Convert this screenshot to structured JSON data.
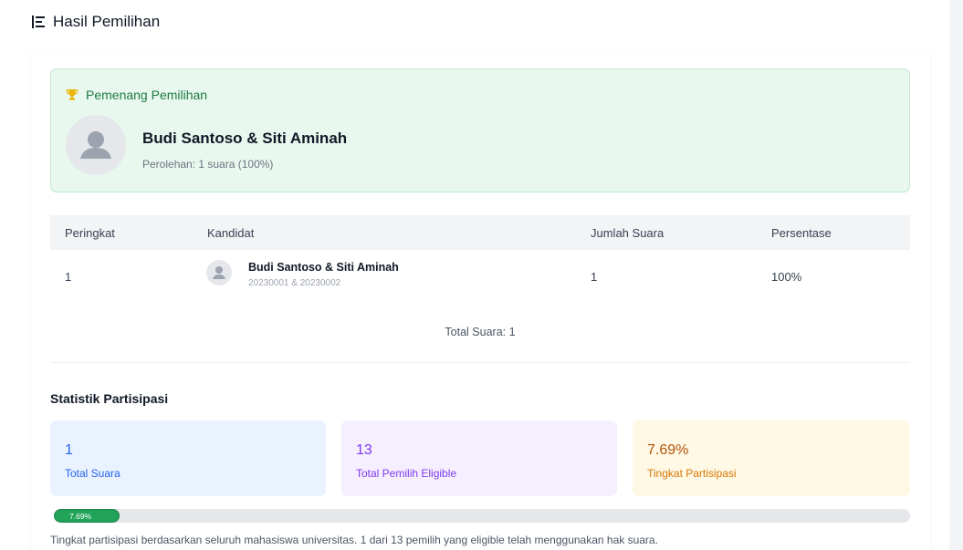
{
  "page": {
    "title": "Hasil Pemilihan",
    "icon": "bar-list-icon"
  },
  "winner": {
    "heading": "Pemenang Pemilihan",
    "icon": "trophy-icon",
    "name": "Budi Santoso & Siti Aminah",
    "votes_text": "Perolehan: 1 suara (100%)"
  },
  "table": {
    "headers": [
      "Peringkat",
      "Kandidat",
      "Jumlah Suara",
      "Persentase"
    ],
    "rows": [
      {
        "rank": "1",
        "name": "Budi Santoso & Siti Aminah",
        "ids": "20230001 & 20230002",
        "votes": "1",
        "percent": "100%"
      }
    ],
    "total_text": "Total Suara: 1"
  },
  "stats": {
    "title": "Statistik Partisipasi",
    "total_votes": {
      "value": "1",
      "label": "Total Suara"
    },
    "eligible": {
      "value": "13",
      "label": "Total Pemilih Eligible"
    },
    "participation": {
      "value": "7.69%",
      "label": "Tingkat Partisipasi"
    },
    "progress": {
      "percent": 7.69,
      "label": "7.69%"
    },
    "footnote": "Tingkat partisipasi berdasarkan seluruh mahasiswa universitas. 1 dari 13 pemilih yang eligible telah menggunakan hak suara."
  },
  "colors": {
    "winner_bg": "#e8f8ee",
    "winner_accent": "#1f7a45",
    "blue": "#2563eb",
    "purple": "#7c3aed",
    "amber": "#d97706",
    "progress": "#22a35a"
  }
}
